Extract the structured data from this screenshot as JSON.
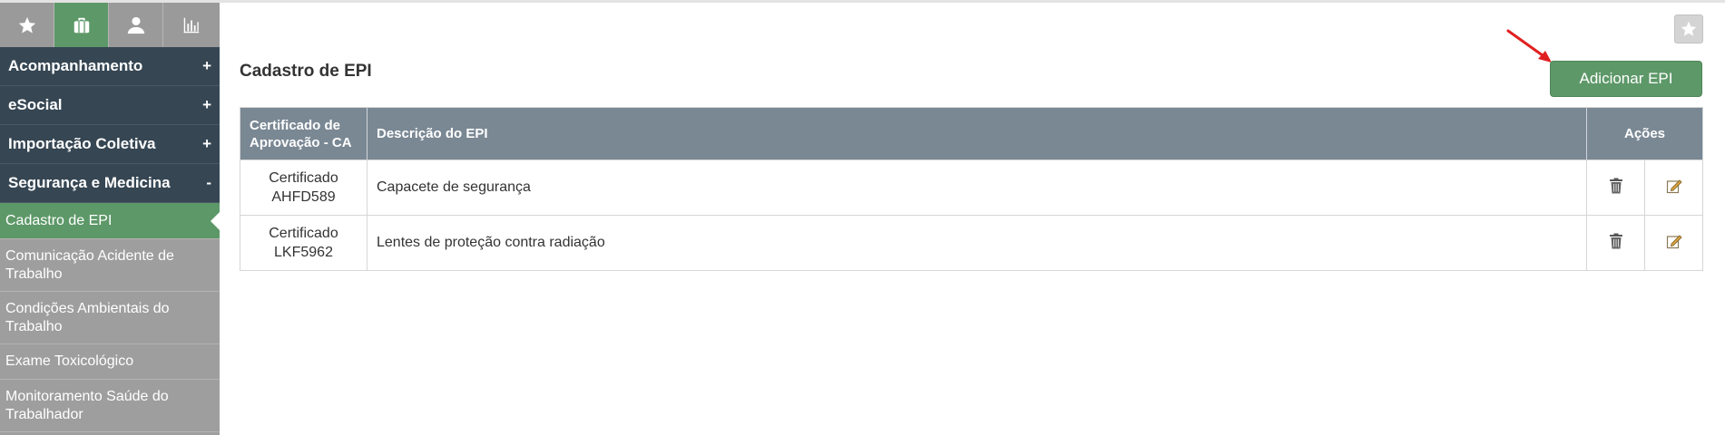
{
  "sidebar": {
    "icon_tabs": [
      {
        "icon": "star-icon"
      },
      {
        "icon": "briefcase-icon",
        "active": true
      },
      {
        "icon": "user-icon"
      },
      {
        "icon": "bar-chart-icon"
      }
    ],
    "sections": [
      {
        "label": "Acompanhamento",
        "sign": "+"
      },
      {
        "label": "eSocial",
        "sign": "+"
      },
      {
        "label": "Importação Coletiva",
        "sign": "+"
      },
      {
        "label": "Segurança e Medicina",
        "sign": "-"
      }
    ],
    "submenu": [
      {
        "label": "Cadastro de EPI",
        "active": true
      },
      {
        "label": "Comunicação Acidente de Trabalho"
      },
      {
        "label": "Condições Ambientais do Trabalho"
      },
      {
        "label": "Exame Toxicológico"
      },
      {
        "label": "Monitoramento Saúde do Trabalhador"
      }
    ]
  },
  "main": {
    "title": "Cadastro de EPI",
    "add_button": "Adicionar EPI",
    "table": {
      "headers": {
        "ca": "Certificado de Aprovação - CA",
        "description": "Descrição do EPI",
        "actions": "Ações"
      },
      "rows": [
        {
          "ca": "Certificado AHFD589",
          "description": "Capacete de segurança"
        },
        {
          "ca": "Certificado LKF5962",
          "description": "Lentes de proteção contra radiação"
        }
      ]
    }
  },
  "colors": {
    "accent_green": "#5d9868",
    "menu_dark": "#364653",
    "table_header": "#7a8894",
    "sidebar_gray": "#9e9e9e",
    "arrow_red": "#e02020"
  }
}
